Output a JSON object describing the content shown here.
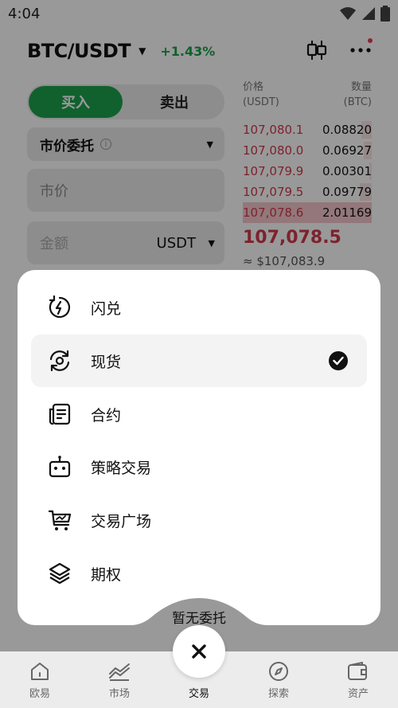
{
  "status": {
    "time": "4:04"
  },
  "header": {
    "pair": "BTC/USDT",
    "change": "+1.43%"
  },
  "trade_form": {
    "buy_label": "买入",
    "sell_label": "卖出",
    "order_type": "市价委托",
    "price_placeholder": "市价",
    "amount_placeholder": "金额",
    "amount_unit": "USDT"
  },
  "order_book": {
    "price_header": "价格",
    "price_unit": "(USDT)",
    "qty_header": "数量",
    "qty_unit": "(BTC)",
    "asks": [
      {
        "price": "107,080.1",
        "qty": "0.08820",
        "depth": 0.08
      },
      {
        "price": "107,080.0",
        "qty": "0.06927",
        "depth": 0.06
      },
      {
        "price": "107,079.9",
        "qty": "0.00301",
        "depth": 0.02
      },
      {
        "price": "107,079.5",
        "qty": "0.09779",
        "depth": 0.09
      },
      {
        "price": "107,078.6",
        "qty": "2.01169",
        "depth": 1.0
      }
    ],
    "last_price": "107,078.5",
    "last_price_usd": "≈ $107,083.9"
  },
  "menu": {
    "items": [
      {
        "label": "闪兑",
        "icon": "flash-swap-icon",
        "selected": false
      },
      {
        "label": "现货",
        "icon": "spot-icon",
        "selected": true
      },
      {
        "label": "合约",
        "icon": "contract-icon",
        "selected": false
      },
      {
        "label": "策略交易",
        "icon": "bot-icon",
        "selected": false
      },
      {
        "label": "交易广场",
        "icon": "trade-square-icon",
        "selected": false
      },
      {
        "label": "期权",
        "icon": "layers-icon",
        "selected": false
      }
    ]
  },
  "empty_state": {
    "text": "暂无委托"
  },
  "tabbar": {
    "items": [
      {
        "label": "欧易",
        "icon": "home-icon"
      },
      {
        "label": "市场",
        "icon": "market-chart-icon"
      },
      {
        "label": "交易",
        "icon": "trade-icon"
      },
      {
        "label": "探索",
        "icon": "compass-icon"
      },
      {
        "label": "资产",
        "icon": "wallet-icon"
      }
    ]
  },
  "colors": {
    "green": "#1ca24d",
    "red": "#d0394b",
    "overlay": "rgba(0,0,0,0.40)"
  }
}
